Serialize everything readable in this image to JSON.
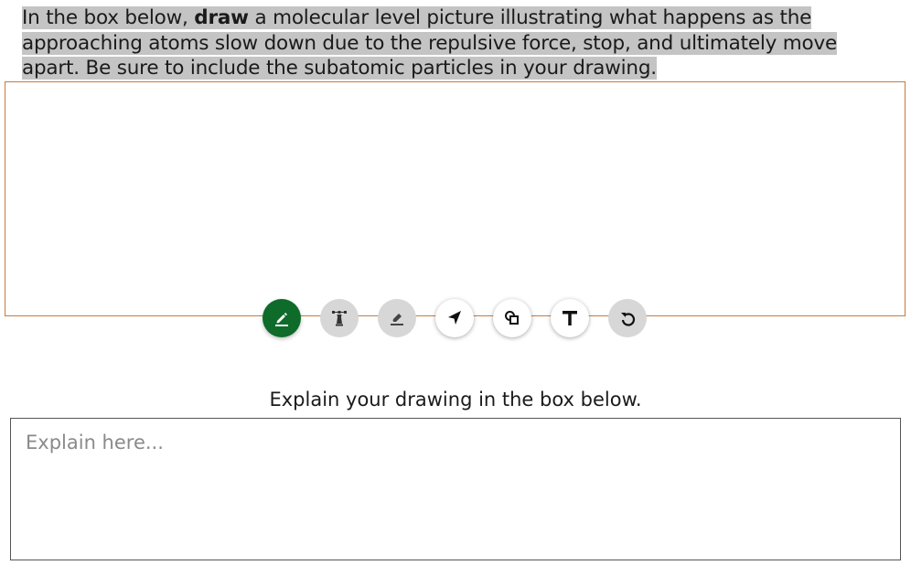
{
  "prompt": {
    "part1": "In the box below, ",
    "bold": "draw",
    "part2": " a molecular level picture illustrating what happens as the approaching atoms slow down due to the repulsive force, stop, and ultimately move apart. Be sure to include the subatomic particles in your drawing."
  },
  "toolbar": {
    "tools": [
      {
        "icon": "pencil-icon",
        "state": "active"
      },
      {
        "icon": "highlighter-icon",
        "state": "disabled"
      },
      {
        "icon": "eraser-icon",
        "state": "disabled"
      },
      {
        "icon": "select-arrow-icon",
        "state": "normal"
      },
      {
        "icon": "shapes-icon",
        "state": "normal"
      },
      {
        "icon": "text-tool-icon",
        "state": "normal"
      },
      {
        "icon": "undo-icon",
        "state": "disabled"
      }
    ]
  },
  "explain": {
    "label": "Explain your drawing in the box below.",
    "placeholder": "Explain here...",
    "value": ""
  },
  "colors": {
    "active_tool": "#0e6b2a",
    "draw_border": "#c87a3c",
    "highlight": "#c4c4c4"
  }
}
